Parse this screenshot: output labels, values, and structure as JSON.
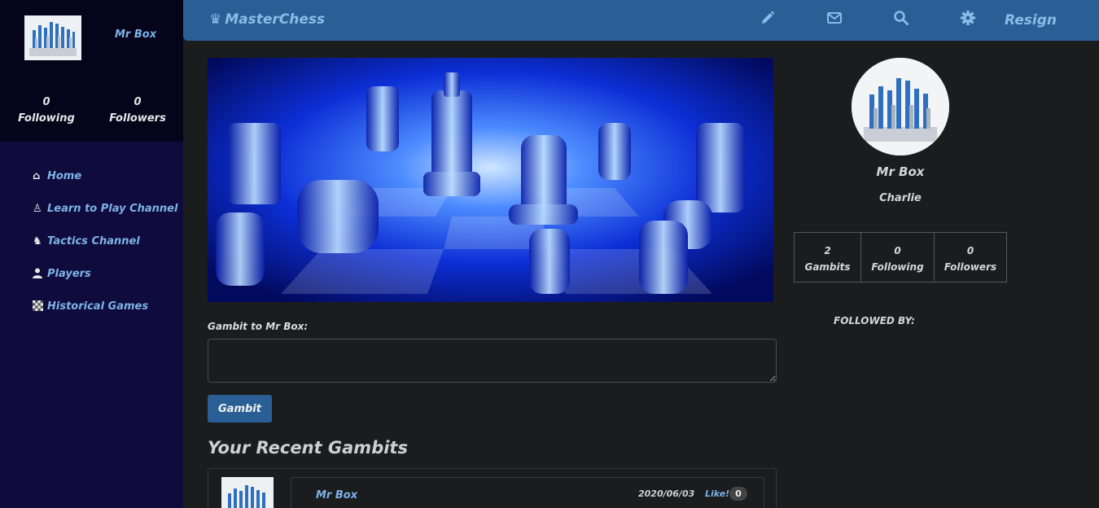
{
  "app": {
    "brand": "MasterChess",
    "resign_label": "Resign"
  },
  "header_icons": [
    "pencil-icon",
    "envelope-icon",
    "search-icon",
    "gear-icon"
  ],
  "sidebar": {
    "username": "Mr Box",
    "stats": [
      {
        "value": "0",
        "label": "Following"
      },
      {
        "value": "0",
        "label": "Followers"
      }
    ],
    "nav": [
      {
        "icon": "home-icon",
        "label": "Home"
      },
      {
        "icon": "chess-pieces-icon",
        "label": "Learn to Play Channel"
      },
      {
        "icon": "knight-icon",
        "label": "Tactics Channel"
      },
      {
        "icon": "user-icon",
        "label": "Players"
      },
      {
        "icon": "chessboard-icon",
        "label": "Historical Games"
      }
    ]
  },
  "main": {
    "gambit_label": "Gambit to Mr Box:",
    "gambit_placeholder": "",
    "gambit_button": "Gambit",
    "recent_title": "Your Recent Gambits",
    "posts": [
      {
        "author": "Mr Box",
        "date": "2020/06/03",
        "like_label": "Like!",
        "likes": "0"
      }
    ]
  },
  "profile": {
    "name": "Mr Box",
    "handle": "Charlie",
    "stats": [
      {
        "value": "2",
        "label": "Gambits"
      },
      {
        "value": "0",
        "label": "Following"
      },
      {
        "value": "0",
        "label": "Followers"
      }
    ],
    "followed_by": "FOLLOWED BY:"
  },
  "colors": {
    "sidebar_bg": "#100b3d",
    "sidebar_top_bg": "#05041a",
    "header_bg": "#2a5f96",
    "accent_text": "#7db2e6",
    "page_bg": "#1b1c1e"
  }
}
